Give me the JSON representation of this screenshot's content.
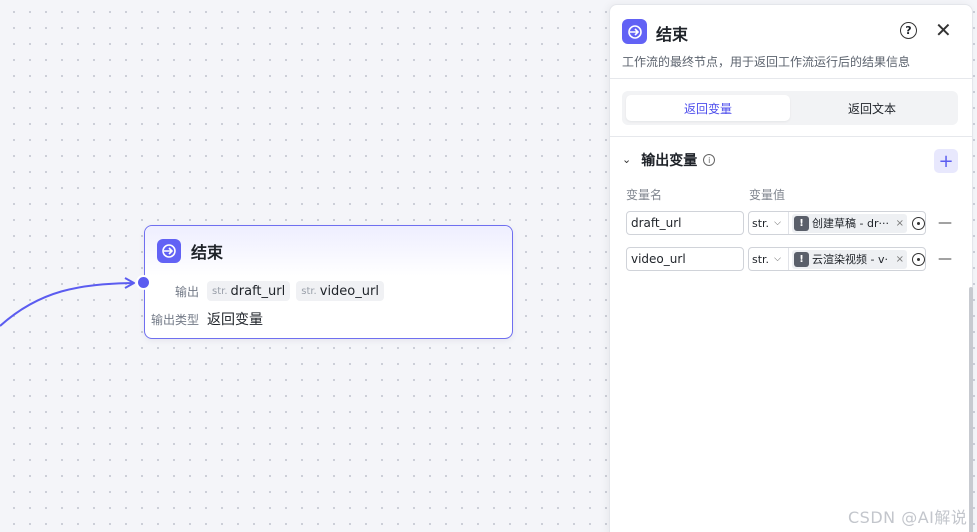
{
  "node": {
    "title": "结束",
    "output_label": "输出",
    "outputs": [
      {
        "type": "str.",
        "name": "draft_url"
      },
      {
        "type": "str.",
        "name": "video_url"
      }
    ],
    "output_type_label": "输出类型",
    "output_type_value": "返回变量"
  },
  "panel": {
    "title": "结束",
    "description": "工作流的最终节点，用于返回工作流运行后的结果信息",
    "tabs": [
      "返回变量",
      "返回文本"
    ],
    "active_tab": "返回变量",
    "section_title": "输出变量",
    "col_name": "变量名",
    "col_value": "变量值",
    "variables": [
      {
        "name": "draft_url",
        "type": "str.",
        "ref": "创建草稿 - dr···"
      },
      {
        "name": "video_url",
        "type": "str.",
        "ref": "云渲染视频 - v·"
      }
    ]
  },
  "watermark": "CSDN @AI解说",
  "colors": {
    "accent": "#5b5cf0",
    "node_border": "#6f6ff0"
  },
  "icons": [
    "node-exit-icon",
    "help-icon",
    "close-icon",
    "chevron-down-icon",
    "info-icon",
    "plus-icon",
    "warning-icon",
    "remove-icon",
    "target-icon",
    "dropdown-icon"
  ]
}
